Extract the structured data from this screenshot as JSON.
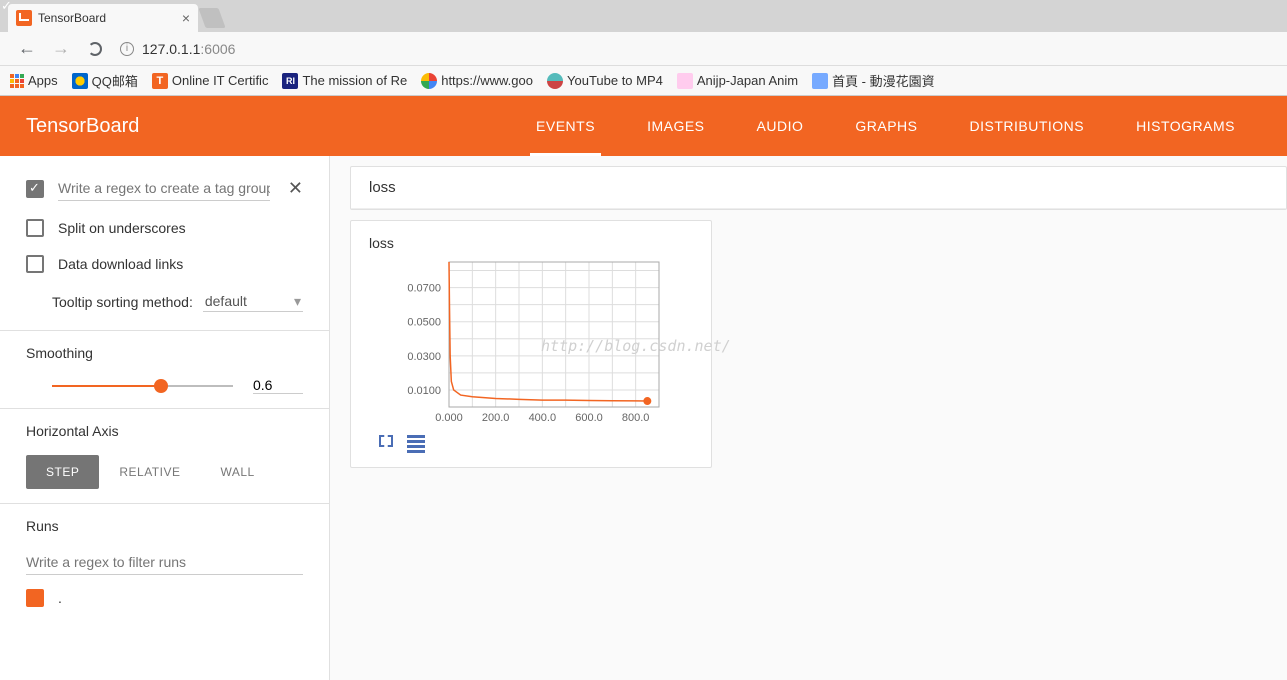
{
  "browser": {
    "tab_title": "TensorBoard",
    "url_host": "127.0.1.1",
    "url_port": ":6006",
    "bookmarks": [
      {
        "label": "Apps"
      },
      {
        "label": "QQ邮箱"
      },
      {
        "label": "Online IT Certific"
      },
      {
        "label": "The mission of Re"
      },
      {
        "label": "https://www.goo"
      },
      {
        "label": "YouTube to MP4"
      },
      {
        "label": "Anijp-Japan Anim"
      },
      {
        "label": "首頁 - 動漫花園資"
      }
    ]
  },
  "header": {
    "title": "TensorBoard",
    "nav": [
      "EVENTS",
      "IMAGES",
      "AUDIO",
      "GRAPHS",
      "DISTRIBUTIONS",
      "HISTOGRAMS"
    ],
    "active": "EVENTS"
  },
  "sidebar": {
    "tag_regex_placeholder": "Write a regex to create a tag group",
    "split_label": "Split on underscores",
    "download_label": "Data download links",
    "tooltip_label": "Tooltip sorting method:",
    "tooltip_value": "default",
    "smoothing_label": "Smoothing",
    "smoothing_value": "0.6",
    "haxis_label": "Horizontal Axis",
    "haxis_buttons": [
      "STEP",
      "RELATIVE",
      "WALL"
    ],
    "haxis_active": "STEP",
    "runs_label": "Runs",
    "runs_placeholder": "Write a regex to filter runs",
    "run_name": "."
  },
  "content": {
    "group_title": "loss",
    "chart_title": "loss",
    "watermark": "http://blog.csdn.net/"
  },
  "chart_data": {
    "type": "line",
    "title": "loss",
    "xlabel": "",
    "ylabel": "",
    "x": [
      0,
      2,
      5,
      10,
      20,
      50,
      100,
      200,
      300,
      400,
      500,
      600,
      700,
      800,
      850
    ],
    "y": [
      0.085,
      0.06,
      0.03,
      0.015,
      0.01,
      0.007,
      0.006,
      0.005,
      0.0045,
      0.004,
      0.004,
      0.0038,
      0.0037,
      0.0036,
      0.0035
    ],
    "x_ticks": [
      "0.000",
      "200.0",
      "400.0",
      "600.0",
      "800.0"
    ],
    "y_ticks": [
      "0.0100",
      "0.0300",
      "0.0500",
      "0.0700"
    ],
    "xlim": [
      0,
      900
    ],
    "ylim": [
      0,
      0.085
    ],
    "last_point": {
      "x": 850,
      "y": 0.0035
    }
  }
}
